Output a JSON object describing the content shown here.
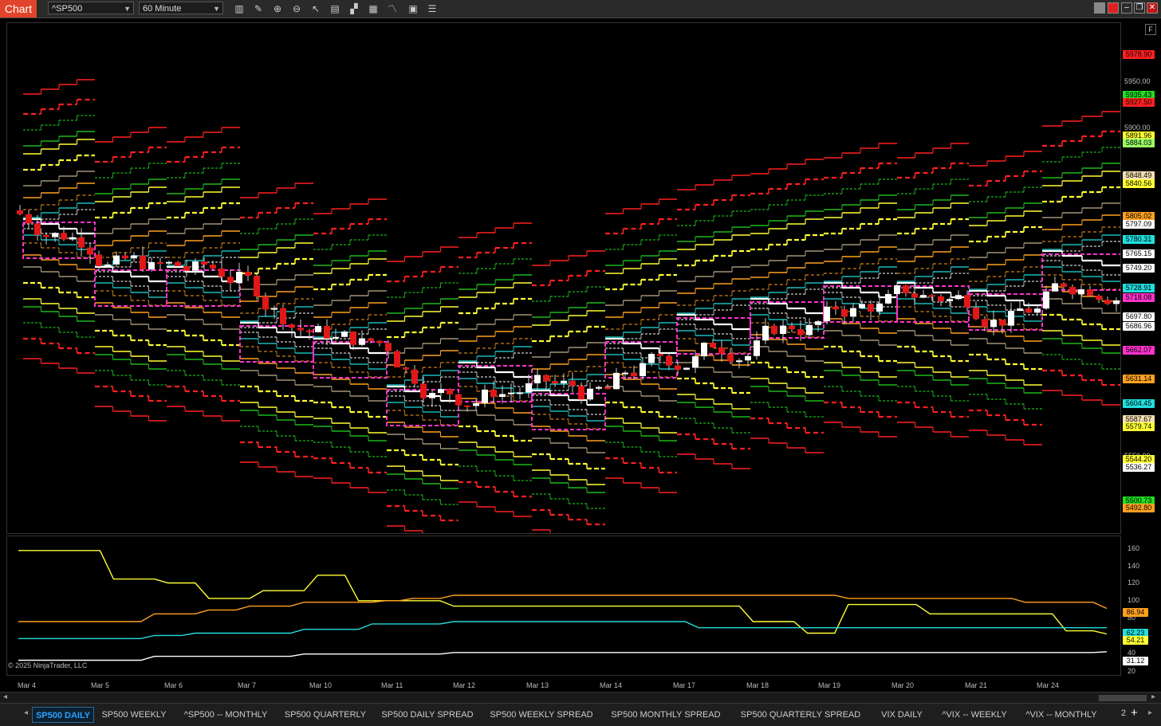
{
  "title_tag": "Chart",
  "instrument": "^SP500",
  "interval": "60 Minute",
  "toolbar_icons": [
    "bar-type-icon",
    "draw-pencil-icon",
    "zoom-in-icon",
    "zoom-out-icon",
    "pointer-icon",
    "data-box-icon",
    "chart-style-icon",
    "indicator-icon",
    "strategy-icon",
    "properties-icon",
    "list-icon"
  ],
  "window_buttons": {
    "minimize": "–",
    "restore": "❐",
    "close": "✕"
  },
  "f_button": "F",
  "copyright": "© 2025 NinjaTrader, LLC",
  "price_ticks": [
    "5950.00",
    "5900.00",
    "5550.00",
    "5500.00"
  ],
  "price_labels": [
    {
      "text": "5978.90",
      "color": "#ff2020"
    },
    {
      "text": "5935.43",
      "color": "#22dd22"
    },
    {
      "text": "5927.50",
      "color": "#ff2020"
    },
    {
      "text": "5891.96",
      "color": "#ffff33"
    },
    {
      "text": "5884.03",
      "color": "#99ff66"
    },
    {
      "text": "5848.49",
      "color": "#f5deb3"
    },
    {
      "text": "5840.56",
      "color": "#ffff33"
    },
    {
      "text": "5805.02",
      "color": "#ffa020"
    },
    {
      "text": "5797.09",
      "color": "#ffffff"
    },
    {
      "text": "5780.31",
      "color": "#22dddd"
    },
    {
      "text": "5765.15",
      "color": "#ffffff"
    },
    {
      "text": "5749.20",
      "color": "#ffffff"
    },
    {
      "text": "5728.91",
      "color": "#22dddd"
    },
    {
      "text": "5718.08",
      "color": "#ff33cc"
    },
    {
      "text": "5697.80",
      "color": "#ffffff"
    },
    {
      "text": "5686.96",
      "color": "#ffffff"
    },
    {
      "text": "5662.07",
      "color": "#ff33cc"
    },
    {
      "text": "5631.14",
      "color": "#ffa020"
    },
    {
      "text": "5604.45",
      "color": "#22dddd"
    },
    {
      "text": "5587.67",
      "color": "#f5deb3"
    },
    {
      "text": "5579.74",
      "color": "#ffff33"
    },
    {
      "text": "5544.20",
      "color": "#ffff33"
    },
    {
      "text": "5536.27",
      "color": "#ffffff"
    },
    {
      "text": "5500.73",
      "color": "#22dd22"
    },
    {
      "text": "5492.80",
      "color": "#ffa020"
    }
  ],
  "indicator_ticks": [
    "160",
    "140",
    "120",
    "100",
    "80",
    "60",
    "40",
    "20"
  ],
  "indicator_labels": [
    {
      "text": "86.94",
      "color": "#ffa020"
    },
    {
      "text": "62.23",
      "color": "#22dddd"
    },
    {
      "text": "54.21",
      "color": "#ffff33"
    },
    {
      "text": "31.12",
      "color": "#ffffff"
    }
  ],
  "indicator_series": {
    "yellow": [
      162,
      162,
      162,
      162,
      162,
      162,
      162,
      125,
      125,
      125,
      125,
      120,
      120,
      120,
      100,
      100,
      100,
      100,
      110,
      110,
      110,
      110,
      130,
      130,
      130,
      97,
      97,
      97,
      97,
      97,
      97,
      97,
      90,
      90,
      90,
      90,
      90,
      90,
      90,
      90,
      90,
      90,
      90,
      90,
      90,
      90,
      90,
      90,
      90,
      90,
      90,
      90,
      90,
      90,
      70,
      70,
      70,
      70,
      55,
      55,
      55,
      92,
      92,
      92,
      92,
      92,
      92,
      80,
      80,
      80,
      80,
      80,
      80,
      80,
      80,
      80,
      80,
      58,
      58,
      58,
      54
    ],
    "orange": [
      70,
      70,
      70,
      70,
      70,
      70,
      70,
      70,
      70,
      70,
      80,
      80,
      80,
      80,
      85,
      85,
      85,
      90,
      90,
      90,
      90,
      95,
      95,
      95,
      95,
      95,
      95,
      97,
      97,
      100,
      100,
      100,
      104,
      104,
      104,
      104,
      104,
      104,
      104,
      104,
      104,
      104,
      104,
      104,
      104,
      104,
      104,
      104,
      104,
      104,
      104,
      104,
      104,
      104,
      104,
      104,
      104,
      104,
      104,
      104,
      104,
      100,
      100,
      100,
      100,
      100,
      100,
      100,
      100,
      100,
      100,
      100,
      100,
      100,
      95,
      95,
      95,
      95,
      95,
      95,
      87
    ],
    "cyan": [
      48,
      48,
      48,
      48,
      48,
      48,
      48,
      48,
      48,
      48,
      52,
      52,
      52,
      55,
      55,
      55,
      55,
      55,
      55,
      55,
      55,
      60,
      60,
      60,
      60,
      60,
      67,
      67,
      67,
      67,
      67,
      67,
      70,
      70,
      70,
      70,
      70,
      70,
      70,
      70,
      70,
      70,
      70,
      70,
      70,
      70,
      70,
      70,
      70,
      70,
      62,
      62,
      62,
      62,
      62,
      62,
      62,
      62,
      62,
      62,
      62,
      62,
      62,
      62,
      62,
      62,
      62,
      62,
      62,
      62,
      62,
      62,
      62,
      62,
      62,
      62,
      62,
      62,
      62,
      62,
      62
    ],
    "white": [
      20,
      20,
      20,
      20,
      20,
      20,
      20,
      20,
      20,
      20,
      25,
      25,
      25,
      25,
      25,
      25,
      25,
      25,
      25,
      25,
      25,
      28,
      28,
      28,
      28,
      28,
      28,
      28,
      28,
      28,
      28,
      28,
      30,
      30,
      30,
      30,
      30,
      30,
      30,
      30,
      30,
      30,
      30,
      30,
      30,
      30,
      30,
      30,
      30,
      30,
      30,
      30,
      30,
      30,
      30,
      30,
      30,
      30,
      30,
      30,
      30,
      30,
      30,
      30,
      30,
      30,
      30,
      30,
      30,
      30,
      30,
      30,
      30,
      30,
      30,
      30,
      30,
      30,
      30,
      30,
      31
    ]
  },
  "x_labels": [
    "Mar 4",
    "Mar 5",
    "Mar 6",
    "Mar 7",
    "Mar 10",
    "Mar 11",
    "Mar 12",
    "Mar 13",
    "Mar 14",
    "Mar 17",
    "Mar 18",
    "Mar 19",
    "Mar 20",
    "Mar 21",
    "Mar 24"
  ],
  "tabs": [
    "SP500 DAILY",
    "SP500 WEEKLY",
    "^SP500 -- MONTHLY",
    "SP500 QUARTERLY",
    "SP500 DAILY SPREAD",
    "SP500 WEEKLY SPREAD",
    "SP500 MONTHLY SPREAD",
    "SP500 QUARTERLY SPREAD",
    "VIX DAILY",
    "^VIX -- WEEKLY",
    "^VIX -- MONTHLY"
  ],
  "active_tab": 0,
  "tab_more": "2",
  "tab_add": "+",
  "tab_scroll": "◂",
  "tab_scroll_right": "▸"
}
